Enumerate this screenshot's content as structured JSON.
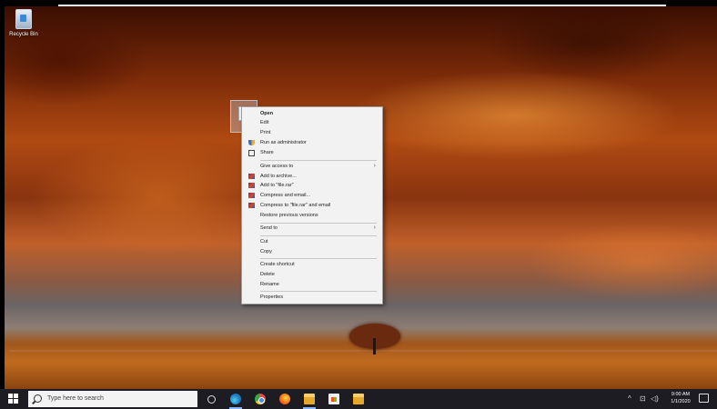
{
  "desktop": {
    "recycle_bin_label": "Recycle Bin"
  },
  "context_menu": {
    "items": [
      {
        "label": "Open",
        "icon": ""
      },
      {
        "label": "Edit",
        "icon": ""
      },
      {
        "label": "Print",
        "icon": ""
      },
      {
        "label": "Run as administrator",
        "icon": "shield-icon"
      },
      {
        "label": "Share",
        "icon": "share-icon"
      },
      {
        "label": "Give access to",
        "icon": "",
        "submenu": true
      },
      {
        "label": "Add to archive...",
        "icon": "winrar-icon"
      },
      {
        "label": "Add to \"file.rar\"",
        "icon": "winrar-icon"
      },
      {
        "label": "Compress and email...",
        "icon": "winrar-icon"
      },
      {
        "label": "Compress to \"file.rar\" and email",
        "icon": "winrar-icon"
      },
      {
        "label": "Restore previous versions",
        "icon": ""
      },
      {
        "label": "Send to",
        "icon": "",
        "submenu": true
      },
      {
        "label": "Cut",
        "icon": ""
      },
      {
        "label": "Copy",
        "icon": ""
      },
      {
        "label": "Create shortcut",
        "icon": ""
      },
      {
        "label": "Delete",
        "icon": ""
      },
      {
        "label": "Rename",
        "icon": ""
      },
      {
        "label": "Properties",
        "icon": ""
      }
    ],
    "submenu_chevron": "›"
  },
  "taskbar": {
    "search_placeholder": "Type here to search",
    "tray_chevron": "^",
    "tray_network": "⊡",
    "tray_volume": "◁)",
    "clock_time": "9:00 AM",
    "clock_date": "1/1/2020"
  },
  "colors": {
    "menu_bg": "#f2f2f2",
    "taskbar_bg": "#1c1c22",
    "active_indicator": "#8ab4f8"
  }
}
